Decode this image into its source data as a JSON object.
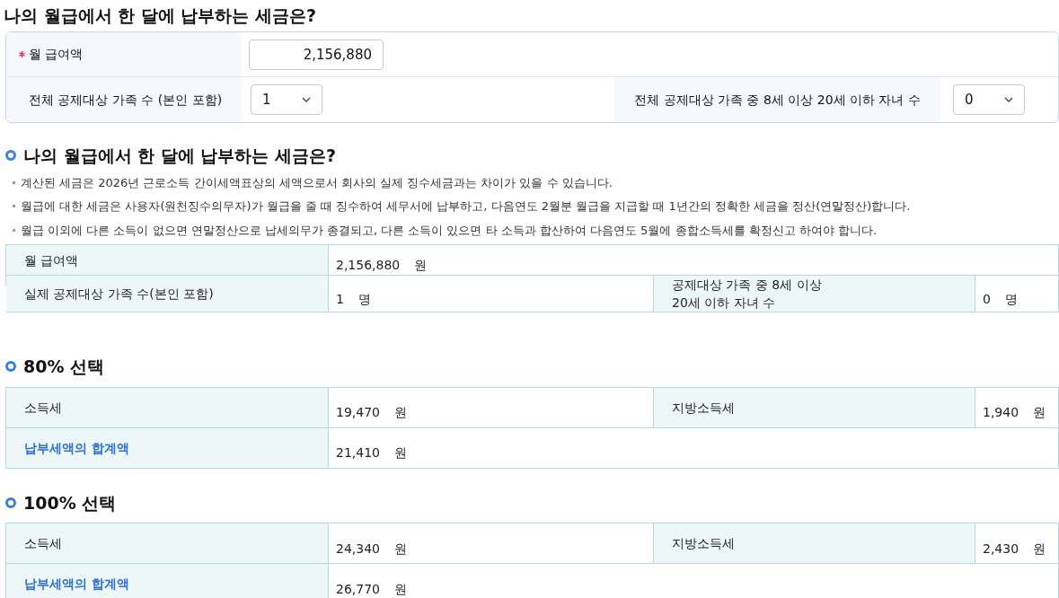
{
  "title": "나의 월급에서 한 달에 납부하는 세금은?",
  "form": {
    "salary": {
      "label": "월 급여액",
      "required": true,
      "value": "2,156,880"
    },
    "family": {
      "label": "전체 공제대상 가족 수 (본인 포함)",
      "value": "1"
    },
    "children": {
      "label": "전체 공제대상 가족 중 8세 이상 20세 이하 자녀 수",
      "value": "0"
    }
  },
  "result": {
    "heading": "나의 월급에서 한 달에 납부하는 세금은?",
    "notes": [
      "계산된 세금은  2026년  근로소득 간이세액표상의 세액으로서 회사의 실제 징수세금과는 차이가 있을 수 있습니다.",
      "월급에 대한 세금은 사용자(원천징수의무자)가 월급을 줄 때 징수하여 세무서에 납부하고, 다음연도 2월분 월급을 지급할 때 1년간의 정확한 세금을 정산(연말정산)합니다.",
      "월급 이외에 다른 소득이 없으면 연말정산으로 납세의무가 종결되고, 다른 소득이 있으면 타 소득과 합산하여 다음연도 5월에 종합소득세를 확정신고 하여야 합니다."
    ],
    "rows": [
      [
        {
          "kind": "label",
          "text": "월 급여액",
          "highlight": false
        },
        {
          "kind": "value",
          "amount": "2,156,880",
          "unit": "원"
        }
      ],
      [
        {
          "kind": "label",
          "text": "실제 공제대상 가족 수(본인 포함)",
          "highlight": false
        },
        {
          "kind": "value",
          "amount": "1",
          "unit": "명"
        },
        {
          "kind": "label",
          "text": "공제대상 가족 중 8세 이상\n20세 이하 자녀 수",
          "highlight": false
        },
        {
          "kind": "value",
          "amount": "0",
          "unit": "명"
        }
      ]
    ]
  },
  "options": [
    {
      "heading": "80% 선택",
      "rows": [
        [
          {
            "kind": "label",
            "text": "소득세",
            "highlight": false
          },
          {
            "kind": "value",
            "amount": "19,470",
            "unit": "원"
          },
          {
            "kind": "label",
            "text": "지방소득세",
            "highlight": false
          },
          {
            "kind": "value",
            "amount": "1,940",
            "unit": "원"
          }
        ],
        [
          {
            "kind": "label",
            "text": "납부세액의 합계액",
            "highlight": true
          },
          {
            "kind": "value",
            "amount": "21,410",
            "unit": "원"
          }
        ]
      ]
    },
    {
      "heading": "100% 선택",
      "rows": [
        [
          {
            "kind": "label",
            "text": "소득세",
            "highlight": false
          },
          {
            "kind": "value",
            "amount": "24,340",
            "unit": "원"
          },
          {
            "kind": "label",
            "text": "지방소득세",
            "highlight": false
          },
          {
            "kind": "value",
            "amount": "2,430",
            "unit": "원"
          }
        ],
        [
          {
            "kind": "label",
            "text": "납부세액의 합계액",
            "highlight": true
          },
          {
            "kind": "value",
            "amount": "26,770",
            "unit": "원"
          }
        ]
      ]
    }
  ]
}
